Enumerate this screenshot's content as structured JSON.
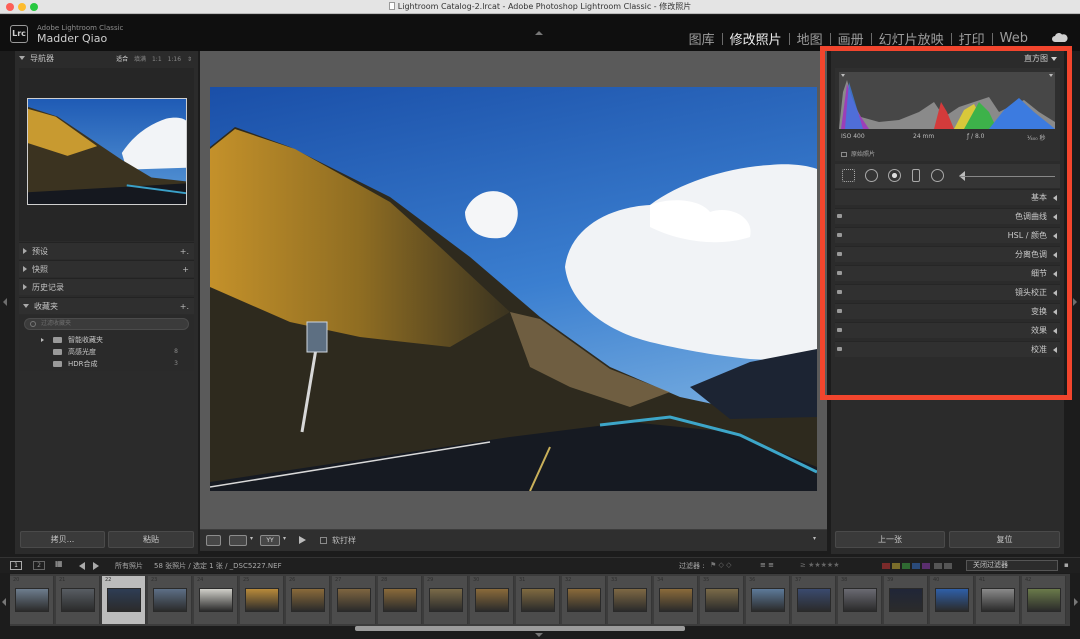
{
  "window": {
    "title": "Lightroom Catalog-2.lrcat - Adobe Photoshop Lightroom Classic - 修改照片"
  },
  "identity": {
    "logo": "Lrc",
    "app_name": "Adobe Lightroom Classic",
    "user": "Madder Qiao"
  },
  "modules": [
    "图库",
    "修改照片",
    "地图",
    "画册",
    "幻灯片放映",
    "打印",
    "Web"
  ],
  "active_module": "修改照片",
  "left_panel": {
    "navigator": {
      "title": "导航器",
      "modes": [
        "适合",
        "填满",
        "1:1",
        "1:16"
      ]
    },
    "sections": [
      {
        "label": "预设",
        "plus": "+."
      },
      {
        "label": "快照",
        "plus": "+"
      },
      {
        "label": "历史记录",
        "plus": ""
      },
      {
        "label": "收藏夹",
        "plus": "+."
      }
    ],
    "collections": {
      "search_placeholder": "过滤收藏夹",
      "items": [
        {
          "name": "智能收藏夹",
          "count": ""
        },
        {
          "name": "高感光度",
          "count": "8"
        },
        {
          "name": "HDR合成",
          "count": "3"
        }
      ]
    },
    "copy_button": "拷贝...",
    "paste_button": "粘贴"
  },
  "toolbar": {
    "before_after": "YY",
    "soft_proof_label": "软打样"
  },
  "right_panel": {
    "histogram": {
      "title": "直方图",
      "iso": "ISO 400",
      "focal": "24 mm",
      "aperture": "ƒ / 8.0",
      "shutter": "¹⁄₄₀₀ 秒",
      "original_photo_label": "原始照片"
    },
    "develop_sections": [
      "基本",
      "色调曲线",
      "HSL / 颜色",
      "分离色调",
      "细节",
      "镜头校正",
      "变换",
      "效果",
      "校准"
    ],
    "prev_button": "上一张",
    "reset_button": "复位",
    "highlight_color": "#f2452d"
  },
  "filmstrip_bar": {
    "pages": [
      "1",
      "2"
    ],
    "source": "所有照片",
    "info": "58 张照片 / 选定 1 张 / _DSC5227.NEF",
    "filter_label": "过滤器 :",
    "filter_value": "关闭过滤器"
  },
  "filmstrip": {
    "numbers": [
      "20",
      "21",
      "22",
      "23",
      "24",
      "25",
      "26",
      "27",
      "28",
      "29",
      "30",
      "31",
      "32",
      "33",
      "34",
      "35",
      "36",
      "37",
      "38",
      "39",
      "40",
      "41",
      "42"
    ],
    "selected_index": 2
  }
}
